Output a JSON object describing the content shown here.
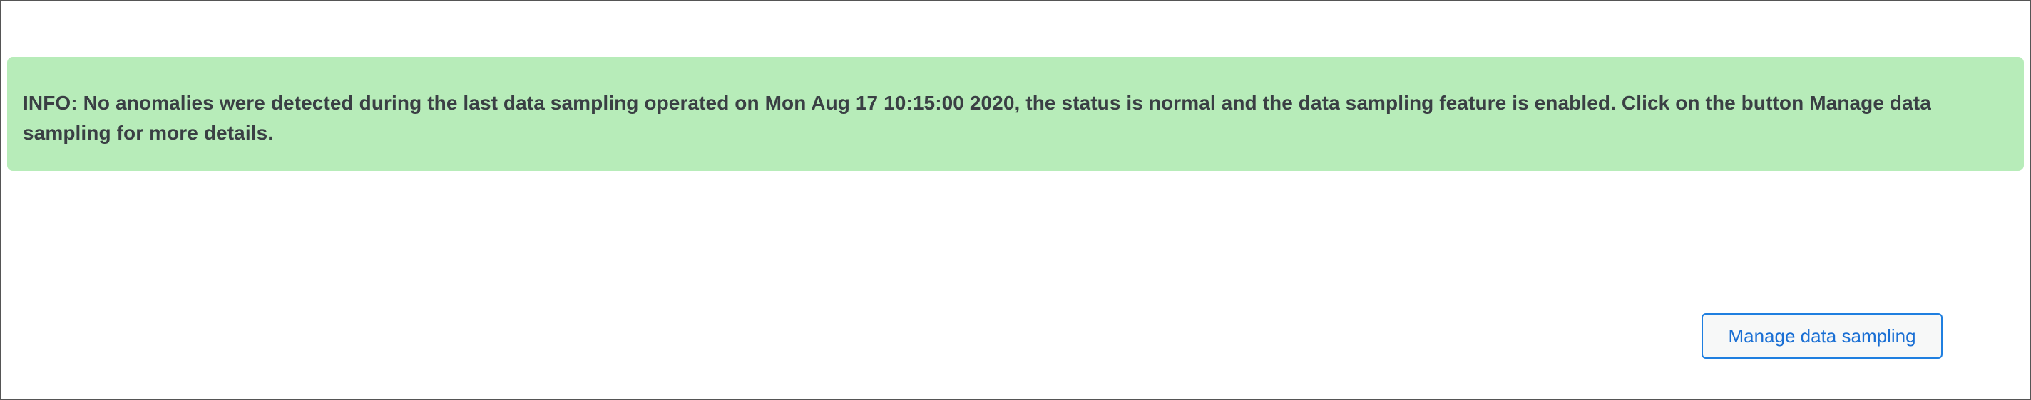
{
  "info_banner": {
    "text": "INFO: No anomalies were detected during the last data sampling operated on Mon Aug 17 10:15:00 2020, the status is normal and the data sampling feature is enabled. Click on the button Manage data sampling for more details.",
    "background_color": "#b7ecb9",
    "text_color": "#3a3f44"
  },
  "actions": {
    "manage_label": "Manage data sampling",
    "accent_color": "#1f7fe0"
  }
}
